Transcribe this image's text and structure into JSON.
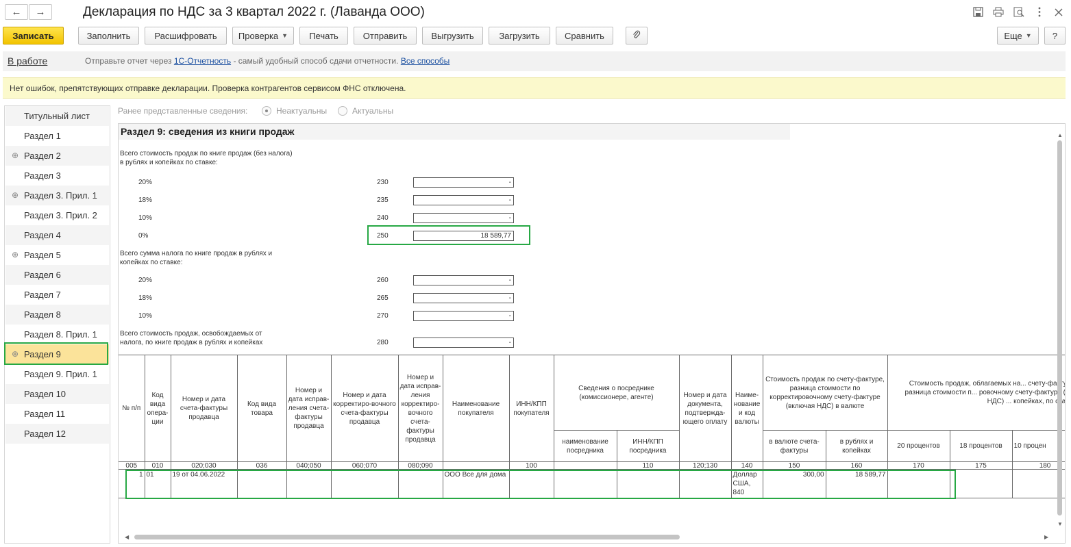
{
  "window": {
    "title": "Декларация по НДС за 3 квартал 2022 г. (Лаванда ООО)",
    "back_icon": "←",
    "forward_icon": "→"
  },
  "toolbar": {
    "save": "Записать",
    "fill": "Заполнить",
    "decode": "Расшифровать",
    "check": "Проверка",
    "print": "Печать",
    "send": "Отправить",
    "export": "Выгрузить",
    "import": "Загрузить",
    "compare": "Сравнить",
    "more": "Еще",
    "help": "?"
  },
  "status": {
    "state": "В работе",
    "message_prefix": "Отправьте отчет через",
    "link_1c": "1С-Отчетность",
    "message_middle": "- самый удобный способ сдачи отчетности.",
    "link_all": "Все способы"
  },
  "notice": "Нет ошибок, препятствующих отправке декларации. Проверка контрагентов сервисом ФНС отключена.",
  "sidebar": {
    "items": [
      {
        "label": "Титульный лист",
        "plus": false
      },
      {
        "label": "Раздел 1",
        "plus": false
      },
      {
        "label": "Раздел 2",
        "plus": true
      },
      {
        "label": "Раздел 3",
        "plus": false
      },
      {
        "label": "Раздел 3. Прил. 1",
        "plus": true
      },
      {
        "label": "Раздел 3. Прил. 2",
        "plus": false
      },
      {
        "label": "Раздел 4",
        "plus": false
      },
      {
        "label": "Раздел 5",
        "plus": true
      },
      {
        "label": "Раздел 6",
        "plus": false
      },
      {
        "label": "Раздел 7",
        "plus": false
      },
      {
        "label": "Раздел 8",
        "plus": false
      },
      {
        "label": "Раздел 8. Прил. 1",
        "plus": false
      },
      {
        "label": "Раздел 9",
        "plus": true,
        "active": true
      },
      {
        "label": "Раздел 9. Прил. 1",
        "plus": false
      },
      {
        "label": "Раздел 10",
        "plus": false
      },
      {
        "label": "Раздел 11",
        "plus": false
      },
      {
        "label": "Раздел 12",
        "plus": false
      }
    ]
  },
  "prior_info": {
    "label": "Ранее представленные сведения:",
    "option_1": "Неактуальны",
    "option_2": "Актуальны",
    "selected": "Неактуальны"
  },
  "report": {
    "title": "Раздел 9: сведения из книги продаж",
    "group_sales_line1": "Всего стоимость продаж по книге продаж (без налога)",
    "group_sales_line2": "в рублях и копейках по ставке:",
    "group_tax_line1": "Всего сумма налога по книге продаж в рублях и",
    "group_tax_line2": "копейках по ставке:",
    "exempt_line1": "Всего стоимость продаж, освобождаемых от",
    "exempt_line2": "налога, по книге продаж в рублях и копейках",
    "rows": [
      {
        "rate": "20%",
        "code": "230",
        "value": "-"
      },
      {
        "rate": "18%",
        "code": "235",
        "value": "-"
      },
      {
        "rate": "10%",
        "code": "240",
        "value": "-"
      },
      {
        "rate": "0%",
        "code": "250",
        "value": "18 589,77"
      },
      {
        "rate": "20%",
        "code": "260",
        "value": "-"
      },
      {
        "rate": "18%",
        "code": "265",
        "value": "-"
      },
      {
        "rate": "10%",
        "code": "270",
        "value": "-"
      },
      {
        "rate": "",
        "code": "280",
        "value": "-"
      }
    ],
    "table": {
      "h_num": "№ п/п",
      "h_op": "Код вида опера-ции",
      "h_invoice": "Номер и дата счета-фактуры продавца",
      "h_goods": "Код вида товара",
      "h_corr_inv": "Номер и дата исправ-ления счета-фактуры продавца",
      "h_adj_inv": "Номер и дата корректиро-вочного счета-фактуры продавца",
      "h_corr_adj": "Номер и дата исправ-ления корректиро-вочного счета-фактуры продавца",
      "h_buyer": "Наименование покупателя",
      "h_inn": "ИНН/КПП покупателя",
      "h_agent": "Сведения о посреднике (комиссионере, агенте)",
      "h_agent_name": "наименование посредника",
      "h_agent_inn": "ИНН/КПП посредника",
      "h_payment": "Номер и дата документа, подтвержда-ющего оплату",
      "h_currency": "Наиме-нование и код валюты",
      "h_cost_incl": "Стоимость продаж по счету-фактуре, разница стоимости по корректировочному счету-фактуре (включая НДС) в валюте",
      "h_cost_inv_cur": "в валюте счета-фактуры",
      "h_cost_rub": "в рублях и копейках",
      "h_taxable": "Стоимость продаж, облагаемых на... счету-фактуре, разница стоимости п... ровочному счету-фактуре (без НДС) ... копейках, по ставке",
      "h_20": "20 процентов",
      "h_18": "18 процентов",
      "h_10": "10 процен",
      "codes": [
        "005",
        "010",
        "020;030",
        "036",
        "040;050",
        "060;070",
        "080;090",
        "",
        "100",
        "",
        "110",
        "120;130",
        "140",
        "150",
        "160",
        "170",
        "175",
        "180"
      ],
      "row": {
        "num": "1",
        "op": "01",
        "invoice": "19 от 04.06.2022",
        "buyer": "ООО Все для дома",
        "currency": "Доллар США, 840",
        "cost_inv_cur": "300,00",
        "cost_rub": "18 589,77"
      }
    }
  }
}
